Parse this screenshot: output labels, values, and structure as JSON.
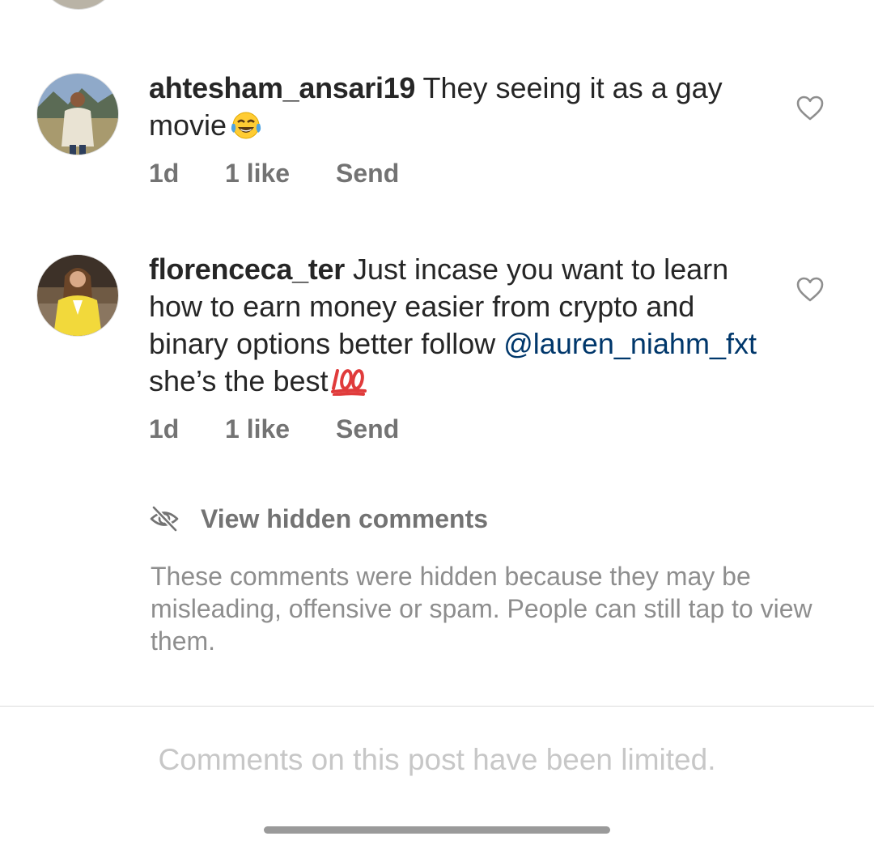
{
  "comments": [
    {
      "username": "ahtesham_ansari19",
      "text": " They seeing it as a gay movie",
      "emoji": "face-with-tears-of-joy",
      "time": "1d",
      "likes": "1 like",
      "send_label": "Send"
    },
    {
      "username": "florenceca_ter",
      "text": " Just incase you want to learn how to earn money easier from crypto and binary options better follow ",
      "mention": "@lauren_niahm_fxt",
      "text_after": " she’s the best",
      "emoji": "hundred-points",
      "time": "1d",
      "likes": "1 like",
      "send_label": "Send"
    }
  ],
  "hidden_comments": {
    "label": "View hidden comments",
    "note": "These comments were hidden because they may be misleading, offensive or spam. People can still tap to view them."
  },
  "footer": {
    "limited_text": "Comments on this post have been limited."
  },
  "colors": {
    "text": "#262626",
    "secondary": "#737373",
    "mention": "#00376b",
    "muted": "#c7c7c7"
  }
}
